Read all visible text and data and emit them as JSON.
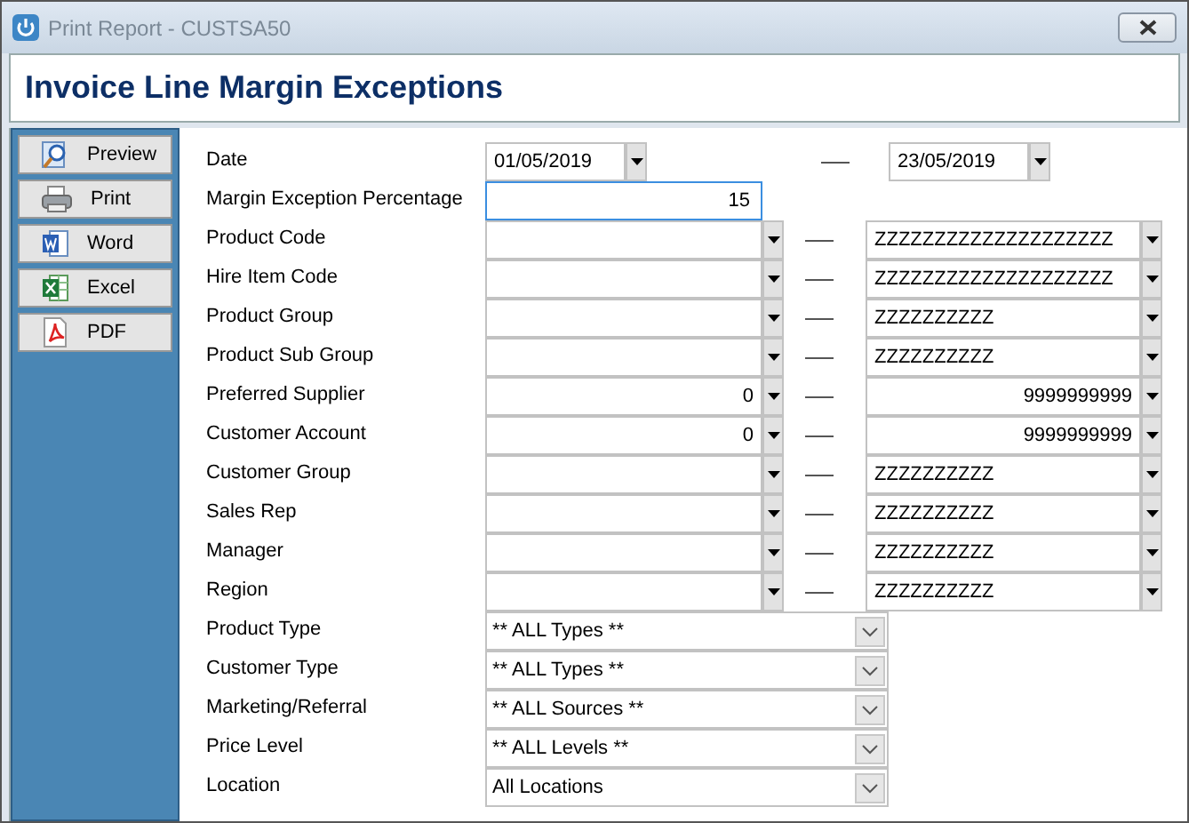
{
  "window": {
    "title": "Print Report - CUSTSA50"
  },
  "header": {
    "title": "Invoice Line Margin Exceptions"
  },
  "actions": [
    {
      "kind": "preview",
      "label": "Preview"
    },
    {
      "kind": "print",
      "label": "Print"
    },
    {
      "kind": "word",
      "label": "Word"
    },
    {
      "kind": "excel",
      "label": "Excel"
    },
    {
      "kind": "pdf",
      "label": "PDF"
    }
  ],
  "form": [
    {
      "kind": "date",
      "label": "Date",
      "from": "01/05/2019",
      "to": "23/05/2019"
    },
    {
      "kind": "number",
      "label": "Margin Exception Percentage",
      "value": "15",
      "focused": true
    },
    {
      "kind": "range",
      "label": "Product Code",
      "to": "ZZZZZZZZZZZZZZZZZZZZ",
      "numeric": false
    },
    {
      "kind": "range",
      "label": "Hire Item Code",
      "to": "ZZZZZZZZZZZZZZZZZZZZ",
      "numeric": false
    },
    {
      "kind": "range",
      "label": "Product Group",
      "to": "ZZZZZZZZZZ",
      "numeric": false
    },
    {
      "kind": "range",
      "label": "Product Sub Group",
      "to": "ZZZZZZZZZZ",
      "numeric": false
    },
    {
      "kind": "range",
      "label": "Preferred Supplier",
      "from": "0",
      "to": "9999999999",
      "numeric": true
    },
    {
      "kind": "range",
      "label": "Customer Account",
      "from": "0",
      "to": "9999999999",
      "numeric": true
    },
    {
      "kind": "range",
      "label": "Customer Group",
      "to": "ZZZZZZZZZZ",
      "numeric": false
    },
    {
      "kind": "range",
      "label": "Sales Rep",
      "to": "ZZZZZZZZZZ",
      "numeric": false
    },
    {
      "kind": "range",
      "label": "Manager",
      "to": "ZZZZZZZZZZ",
      "numeric": false
    },
    {
      "kind": "range",
      "label": "Region",
      "to": "ZZZZZZZZZZ",
      "numeric": false
    },
    {
      "kind": "select",
      "label": "Product Type",
      "value": "** ALL Types **"
    },
    {
      "kind": "select",
      "label": "Customer Type",
      "value": "** ALL Types **"
    },
    {
      "kind": "select",
      "label": "Marketing/Referral",
      "value": "** ALL Sources **"
    },
    {
      "kind": "select",
      "label": "Price Level",
      "value": "** ALL Levels **"
    },
    {
      "kind": "select",
      "label": "Location",
      "value": "All Locations"
    }
  ]
}
